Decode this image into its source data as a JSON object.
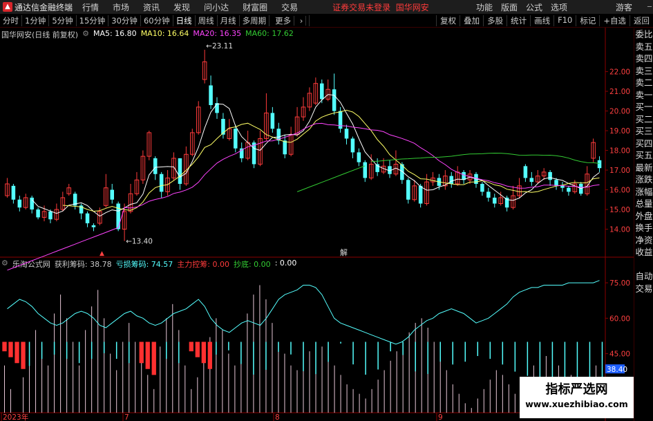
{
  "app": {
    "logo_label": "通达信金融终端",
    "menu": [
      "行情",
      "市场",
      "资讯",
      "发现",
      "问小达",
      "财富圈",
      "交易"
    ],
    "login_notice": "证券交易未登录",
    "stock_name_top": "国华网安",
    "right_menu": [
      "功能",
      "版面",
      "公式",
      "选项"
    ],
    "guest": "游客"
  },
  "toolbar": {
    "periods": [
      "分时",
      "1分钟",
      "5分钟",
      "15分钟",
      "30分钟",
      "60分钟",
      "日线",
      "周线",
      "月线",
      "多周期",
      "更多"
    ],
    "active_period": "日线",
    "actions": [
      "复权",
      "叠加",
      "多股",
      "统计",
      "画线",
      "F10",
      "标记",
      "+自选",
      "返回"
    ]
  },
  "main_legend": {
    "title": "国华网安(日线 前复权)",
    "ma5": "MA5: 16.80",
    "ma10": "MA10: 16.64",
    "ma20": "MA20: 16.35",
    "ma60": "MA60: 17.62"
  },
  "colors": {
    "up": "#ff3b3b",
    "down": "#54ffff",
    "ma5": "#ffffff",
    "ma10": "#ffff66",
    "ma20": "#ff44ff",
    "ma60": "#33cc33",
    "axis": "#8b0000"
  },
  "price_axis": [
    "22.00",
    "21.00",
    "20.00",
    "19.00",
    "18.00",
    "17.00",
    "16.00",
    "15.00",
    "14.00"
  ],
  "annotations": {
    "high": "23.11",
    "low": "13.40",
    "marker": "解"
  },
  "indicator_legend": {
    "name": "乐淘公式网",
    "profit": "获利筹码: 38.78",
    "loss": "亏损筹码: 74.57",
    "main_force": "主力控筹: 0.00",
    "bottom": "抄底: 0.00",
    "extra": ": 0.00"
  },
  "indicator_axis": [
    "75.00",
    "60.00",
    "45.00",
    "30.00"
  ],
  "indicator_current": "38.40",
  "date_axis": [
    "2023年",
    "7",
    "8",
    "9"
  ],
  "sidebar": [
    "委比",
    "卖五",
    "卖四",
    "卖三",
    "卖二",
    "卖一",
    "买一",
    "买二",
    "买三",
    "买四",
    "买五",
    "最新",
    "涨跌",
    "涨幅",
    "总量",
    "外盘",
    "换手",
    "净资",
    "收益",
    "",
    "自动",
    "交易"
  ],
  "watermark": {
    "line1": "指标严选网",
    "line2": "www.xuezhibiao.com"
  },
  "chart_data": {
    "type": "candlestick",
    "candles": [
      {
        "o": 15.7,
        "c": 16.3,
        "h": 16.6,
        "l": 15.6
      },
      {
        "o": 16.2,
        "c": 15.5,
        "h": 16.3,
        "l": 15.3
      },
      {
        "o": 15.5,
        "c": 15.1,
        "h": 15.7,
        "l": 14.9
      },
      {
        "o": 15.1,
        "c": 15.6,
        "h": 15.8,
        "l": 15.0
      },
      {
        "o": 15.6,
        "c": 15.0,
        "h": 15.7,
        "l": 14.8
      },
      {
        "o": 15.0,
        "c": 14.6,
        "h": 15.1,
        "l": 14.5
      },
      {
        "o": 14.6,
        "c": 14.9,
        "h": 15.2,
        "l": 14.4
      },
      {
        "o": 14.9,
        "c": 14.5,
        "h": 15.0,
        "l": 14.3
      },
      {
        "o": 14.5,
        "c": 15.0,
        "h": 15.3,
        "l": 14.4
      },
      {
        "o": 15.0,
        "c": 15.6,
        "h": 15.9,
        "l": 14.9
      },
      {
        "o": 15.8,
        "c": 16.1,
        "h": 16.3,
        "l": 15.7
      },
      {
        "o": 15.8,
        "c": 15.2,
        "h": 15.9,
        "l": 15.0
      },
      {
        "o": 15.2,
        "c": 14.8,
        "h": 15.3,
        "l": 14.5
      },
      {
        "o": 14.8,
        "c": 14.3,
        "h": 14.9,
        "l": 14.1
      },
      {
        "o": 14.2,
        "c": 14.1,
        "h": 14.3,
        "l": 13.9
      },
      {
        "o": 14.3,
        "c": 14.9,
        "h": 15.1,
        "l": 14.2
      },
      {
        "o": 15.2,
        "c": 16.1,
        "h": 16.8,
        "l": 15.1
      },
      {
        "o": 16.0,
        "c": 15.5,
        "h": 16.3,
        "l": 15.3
      },
      {
        "o": 15.3,
        "c": 14.0,
        "h": 15.4,
        "l": 13.9
      },
      {
        "o": 14.0,
        "c": 14.9,
        "h": 15.3,
        "l": 13.4
      },
      {
        "o": 14.9,
        "c": 15.8,
        "h": 16.3,
        "l": 14.8
      },
      {
        "o": 15.8,
        "c": 16.5,
        "h": 16.9,
        "l": 15.7
      },
      {
        "o": 16.5,
        "c": 17.7,
        "h": 18.0,
        "l": 16.3
      },
      {
        "o": 17.7,
        "c": 18.9,
        "h": 19.0,
        "l": 17.5
      },
      {
        "o": 17.6,
        "c": 16.8,
        "h": 17.7,
        "l": 16.5
      },
      {
        "o": 16.8,
        "c": 15.9,
        "h": 16.9,
        "l": 15.6
      },
      {
        "o": 15.9,
        "c": 16.6,
        "h": 17.0,
        "l": 15.7
      },
      {
        "o": 16.6,
        "c": 17.6,
        "h": 17.9,
        "l": 16.5
      },
      {
        "o": 17.6,
        "c": 16.3,
        "h": 17.6,
        "l": 16.0
      },
      {
        "o": 16.3,
        "c": 17.8,
        "h": 18.2,
        "l": 16.2
      },
      {
        "o": 17.8,
        "c": 18.9,
        "h": 19.1,
        "l": 17.7
      },
      {
        "o": 18.9,
        "c": 20.2,
        "h": 20.5,
        "l": 18.8
      },
      {
        "o": 21.6,
        "c": 22.5,
        "h": 23.11,
        "l": 21.4
      },
      {
        "o": 21.3,
        "c": 20.3,
        "h": 21.8,
        "l": 20.1
      },
      {
        "o": 20.4,
        "c": 19.9,
        "h": 20.7,
        "l": 19.6
      },
      {
        "o": 19.6,
        "c": 18.8,
        "h": 19.9,
        "l": 18.6
      },
      {
        "o": 18.6,
        "c": 19.1,
        "h": 19.6,
        "l": 18.5
      },
      {
        "o": 19.1,
        "c": 18.1,
        "h": 19.3,
        "l": 17.9
      },
      {
        "o": 18.1,
        "c": 17.6,
        "h": 18.4,
        "l": 17.4
      },
      {
        "o": 17.6,
        "c": 18.4,
        "h": 19.0,
        "l": 17.5
      },
      {
        "o": 18.4,
        "c": 17.3,
        "h": 18.5,
        "l": 17.1
      },
      {
        "o": 17.3,
        "c": 18.6,
        "h": 19.0,
        "l": 17.2
      },
      {
        "o": 18.6,
        "c": 19.9,
        "h": 20.9,
        "l": 18.5
      },
      {
        "o": 19.9,
        "c": 19.1,
        "h": 20.2,
        "l": 18.9
      },
      {
        "o": 19.1,
        "c": 18.5,
        "h": 19.4,
        "l": 18.3
      },
      {
        "o": 18.5,
        "c": 17.8,
        "h": 18.8,
        "l": 17.6
      },
      {
        "o": 17.8,
        "c": 18.8,
        "h": 19.2,
        "l": 17.7
      },
      {
        "o": 18.8,
        "c": 19.7,
        "h": 20.2,
        "l": 18.7
      },
      {
        "o": 19.7,
        "c": 20.2,
        "h": 20.7,
        "l": 19.5
      },
      {
        "o": 20.2,
        "c": 20.9,
        "h": 21.2,
        "l": 20.0
      },
      {
        "o": 20.4,
        "c": 21.4,
        "h": 21.7,
        "l": 20.3
      },
      {
        "o": 21.4,
        "c": 20.6,
        "h": 21.6,
        "l": 20.4
      },
      {
        "o": 20.6,
        "c": 21.1,
        "h": 21.6,
        "l": 20.5
      },
      {
        "o": 21.1,
        "c": 20.0,
        "h": 21.9,
        "l": 19.8
      },
      {
        "o": 20.0,
        "c": 19.1,
        "h": 20.2,
        "l": 18.9
      },
      {
        "o": 19.1,
        "c": 18.6,
        "h": 19.3,
        "l": 18.3
      },
      {
        "o": 18.6,
        "c": 17.9,
        "h": 18.7,
        "l": 17.6
      },
      {
        "o": 17.9,
        "c": 17.4,
        "h": 18.1,
        "l": 17.2
      },
      {
        "o": 17.4,
        "c": 16.6,
        "h": 17.5,
        "l": 16.4
      },
      {
        "o": 16.6,
        "c": 17.3,
        "h": 17.8,
        "l": 16.5
      },
      {
        "o": 17.3,
        "c": 16.9,
        "h": 17.6,
        "l": 16.7
      },
      {
        "o": 16.9,
        "c": 17.2,
        "h": 17.6,
        "l": 16.8
      },
      {
        "o": 17.2,
        "c": 16.8,
        "h": 17.5,
        "l": 16.6
      },
      {
        "o": 16.8,
        "c": 17.3,
        "h": 18.0,
        "l": 16.7
      },
      {
        "o": 17.3,
        "c": 16.5,
        "h": 17.4,
        "l": 16.3
      },
      {
        "o": 16.5,
        "c": 15.5,
        "h": 16.6,
        "l": 15.3
      },
      {
        "o": 15.5,
        "c": 16.2,
        "h": 16.5,
        "l": 15.4
      },
      {
        "o": 16.2,
        "c": 15.3,
        "h": 16.3,
        "l": 15.1
      },
      {
        "o": 15.3,
        "c": 16.4,
        "h": 16.8,
        "l": 15.2
      },
      {
        "o": 16.4,
        "c": 16.6,
        "h": 16.9,
        "l": 16.2
      },
      {
        "o": 16.6,
        "c": 16.2,
        "h": 16.8,
        "l": 16.0
      },
      {
        "o": 16.2,
        "c": 16.7,
        "h": 17.0,
        "l": 16.0
      },
      {
        "o": 16.7,
        "c": 16.3,
        "h": 16.9,
        "l": 16.1
      },
      {
        "o": 16.3,
        "c": 16.9,
        "h": 17.2,
        "l": 16.2
      },
      {
        "o": 16.9,
        "c": 16.5,
        "h": 17.0,
        "l": 16.3
      },
      {
        "o": 16.5,
        "c": 16.8,
        "h": 17.0,
        "l": 16.3
      },
      {
        "o": 16.8,
        "c": 16.3,
        "h": 16.9,
        "l": 16.1
      },
      {
        "o": 16.3,
        "c": 15.9,
        "h": 16.4,
        "l": 15.7
      },
      {
        "o": 15.9,
        "c": 15.6,
        "h": 16.1,
        "l": 15.4
      },
      {
        "o": 15.6,
        "c": 15.3,
        "h": 15.8,
        "l": 15.1
      },
      {
        "o": 15.3,
        "c": 15.6,
        "h": 15.9,
        "l": 15.2
      },
      {
        "o": 15.6,
        "c": 15.1,
        "h": 15.7,
        "l": 14.9
      },
      {
        "o": 15.1,
        "c": 15.7,
        "h": 16.2,
        "l": 15.0
      },
      {
        "o": 15.7,
        "c": 16.2,
        "h": 16.6,
        "l": 15.6
      },
      {
        "o": 17.2,
        "c": 16.6,
        "h": 17.3,
        "l": 16.4
      },
      {
        "o": 16.6,
        "c": 16.4,
        "h": 16.9,
        "l": 16.2
      },
      {
        "o": 16.4,
        "c": 16.7,
        "h": 17.0,
        "l": 16.3
      },
      {
        "o": 16.7,
        "c": 16.9,
        "h": 17.1,
        "l": 16.5
      },
      {
        "o": 16.9,
        "c": 16.5,
        "h": 17.0,
        "l": 16.2
      },
      {
        "o": 16.5,
        "c": 16.2,
        "h": 16.6,
        "l": 16.0
      },
      {
        "o": 16.2,
        "c": 16.1,
        "h": 16.4,
        "l": 15.9
      },
      {
        "o": 16.1,
        "c": 15.9,
        "h": 16.2,
        "l": 15.7
      },
      {
        "o": 15.9,
        "c": 16.3,
        "h": 16.5,
        "l": 15.8
      },
      {
        "o": 16.3,
        "c": 15.8,
        "h": 16.4,
        "l": 15.7
      },
      {
        "o": 15.8,
        "c": 16.8,
        "h": 17.2,
        "l": 15.7
      },
      {
        "o": 17.6,
        "c": 18.4,
        "h": 18.6,
        "l": 17.4
      },
      {
        "o": 17.5,
        "c": 17.1,
        "h": 17.7,
        "l": 16.9
      }
    ],
    "indicator_line": [
      64,
      66,
      68,
      67,
      65,
      62,
      60,
      58,
      57,
      58,
      60,
      62,
      63,
      62,
      60,
      57,
      56,
      58,
      60,
      62,
      63,
      61,
      60,
      58,
      57,
      58,
      60,
      62,
      63,
      64,
      66,
      68,
      65,
      60,
      57,
      55,
      54,
      56,
      58,
      59,
      58,
      57,
      60,
      64,
      68,
      70,
      71,
      72,
      74,
      74,
      73,
      70,
      65,
      60,
      58,
      57,
      56,
      55,
      54,
      53,
      52,
      51,
      50,
      49,
      50,
      52,
      55,
      57,
      59,
      60,
      62,
      63,
      64,
      63,
      62,
      60,
      58,
      59,
      60,
      62,
      64,
      66,
      69,
      71,
      72,
      73,
      73,
      74,
      74,
      74,
      74,
      75,
      75,
      75,
      75,
      75,
      76
    ],
    "indicator_bars_mode": "mixed"
  }
}
